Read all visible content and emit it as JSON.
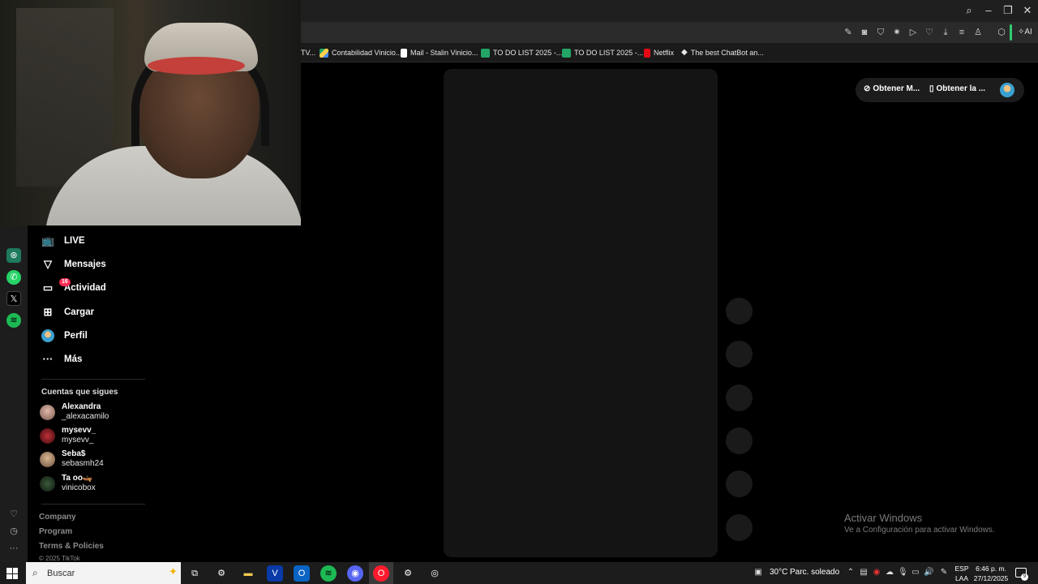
{
  "bookmarks": [
    {
      "label": "TV..."
    },
    {
      "label": "Contabilidad Vinicio...",
      "icon": "drive-icon"
    },
    {
      "label": "Mail - Stalin Vinicio...",
      "icon": "doc-icon"
    },
    {
      "label": "TO DO LIST 2025 -...",
      "icon": "sheets-icon"
    },
    {
      "label": "TO DO LIST 2025 -...",
      "icon": "sheets-icon"
    },
    {
      "label": "Netflix",
      "icon": "netflix-icon"
    },
    {
      "label": "The best ChatBot an...",
      "icon": "diamond-icon"
    }
  ],
  "toolbar": {
    "ai_label": "AI"
  },
  "nav": {
    "items": [
      {
        "label": "LIVE",
        "icon": "live-icon"
      },
      {
        "label": "Mensajes",
        "icon": "messages-icon"
      },
      {
        "label": "Actividad",
        "icon": "activity-icon",
        "badge": "16"
      },
      {
        "label": "Cargar",
        "icon": "upload-icon"
      },
      {
        "label": "Perfil",
        "icon": "profile-icon"
      },
      {
        "label": "Más",
        "icon": "more-icon"
      }
    ],
    "following_title": "Cuentas que sigues",
    "accounts": [
      {
        "name": "Alexandra",
        "user": "_alexacamilo"
      },
      {
        "name": "mysevv_",
        "user": "mysevv_"
      },
      {
        "name": "Seba$",
        "user": "sebasmh24"
      },
      {
        "name": "Ta oo🛶",
        "user": "vinicobox"
      }
    ],
    "footer": [
      "Company",
      "Program",
      "Terms & Policies",
      "© 2025 TikTok"
    ]
  },
  "header_pill": {
    "btn1": "Obtener M...",
    "btn2": "Obtener la ..."
  },
  "watermark": {
    "line1": "Activar Windows",
    "line2": "Ve a Configuración para activar Windows."
  },
  "taskbar": {
    "search_placeholder": "Buscar",
    "weather_temp": "30°C",
    "weather_desc": "Parc. soleado",
    "lang_top": "ESP",
    "lang_bottom": "LAA",
    "time": "6:46 p. m.",
    "date": "27/12/2025",
    "notif_count": "9"
  },
  "colors": {
    "accent": "#fe2c55",
    "green": "#2ecc71"
  }
}
